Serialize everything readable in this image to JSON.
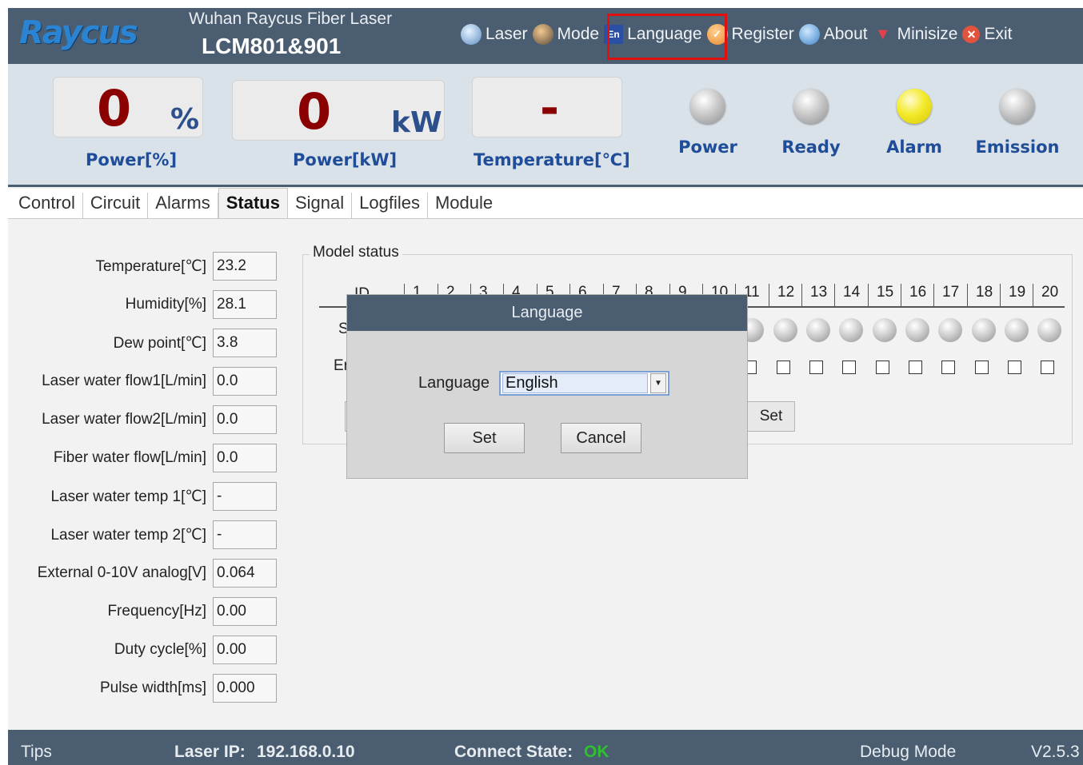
{
  "header": {
    "logo": "Raycus",
    "company": "Wuhan Raycus Fiber Laser",
    "model": "LCM801&901",
    "menu": [
      {
        "label": "Laser",
        "icon": "globe-icon"
      },
      {
        "label": "Mode",
        "icon": "users-icon"
      },
      {
        "label": "Language",
        "icon": "En",
        "highlighted": true
      },
      {
        "label": "Register",
        "icon": "key-icon"
      },
      {
        "label": "About",
        "icon": "info-globe-icon"
      },
      {
        "label": "Minisize",
        "icon": "minimize-arrow-icon"
      },
      {
        "label": "Exit",
        "icon": "close-icon"
      }
    ]
  },
  "gauges": {
    "power_pct": {
      "value": "0",
      "unit": "%",
      "label": "Power[%]"
    },
    "power_kw": {
      "value": "0",
      "unit": "kW",
      "label": "Power[kW]"
    },
    "temperature": {
      "value": "-",
      "label": "Temperature[℃]"
    }
  },
  "indicators": [
    {
      "label": "Power",
      "on": false
    },
    {
      "label": "Ready",
      "on": false
    },
    {
      "label": "Alarm",
      "on": true,
      "color": "#f3ea2c"
    },
    {
      "label": "Emission",
      "on": false
    }
  ],
  "tabs": [
    "Control",
    "Circuit",
    "Alarms",
    "Status",
    "Signal",
    "Logfiles",
    "Module"
  ],
  "active_tab": "Status",
  "fields": [
    {
      "label": "Temperature[℃]",
      "value": "23.2"
    },
    {
      "label": "Humidity[%]",
      "value": "28.1"
    },
    {
      "label": "Dew point[℃]",
      "value": "3.8"
    },
    {
      "label": "Laser water flow1[L/min]",
      "value": "0.0"
    },
    {
      "label": "Laser water flow2[L/min]",
      "value": "0.0"
    },
    {
      "label": "Fiber water flow[L/min]",
      "value": "0.0"
    },
    {
      "label": "Laser water temp 1[℃]",
      "value": "-"
    },
    {
      "label": "Laser water temp 2[℃]",
      "value": "-"
    },
    {
      "label": "External 0-10V analog[V]",
      "value": "0.064"
    },
    {
      "label": "Frequency[Hz]",
      "value": "0.00"
    },
    {
      "label": "Duty cycle[%]",
      "value": "0.00"
    },
    {
      "label": "Pulse width[ms]",
      "value": "0.000"
    }
  ],
  "model_status": {
    "title": "Model status",
    "id_header": "ID",
    "ids": [
      "1",
      "2",
      "3",
      "4",
      "5",
      "6",
      "7",
      "8",
      "9",
      "10",
      "11",
      "12",
      "13",
      "14",
      "15",
      "16",
      "17",
      "18",
      "19",
      "20"
    ],
    "row1_label": "S",
    "row2_label": "Er",
    "set_label": "Set"
  },
  "dialog": {
    "title": "Language",
    "label": "Language",
    "selected": "English",
    "set": "Set",
    "cancel": "Cancel"
  },
  "footer": {
    "tips": "Tips",
    "ip_label": "Laser IP:",
    "ip": "192.168.0.10",
    "conn_label": "Connect State:",
    "conn": "OK",
    "conn_color": "#2ec02e",
    "mode": "Debug Mode",
    "version": "V2.5.3"
  }
}
